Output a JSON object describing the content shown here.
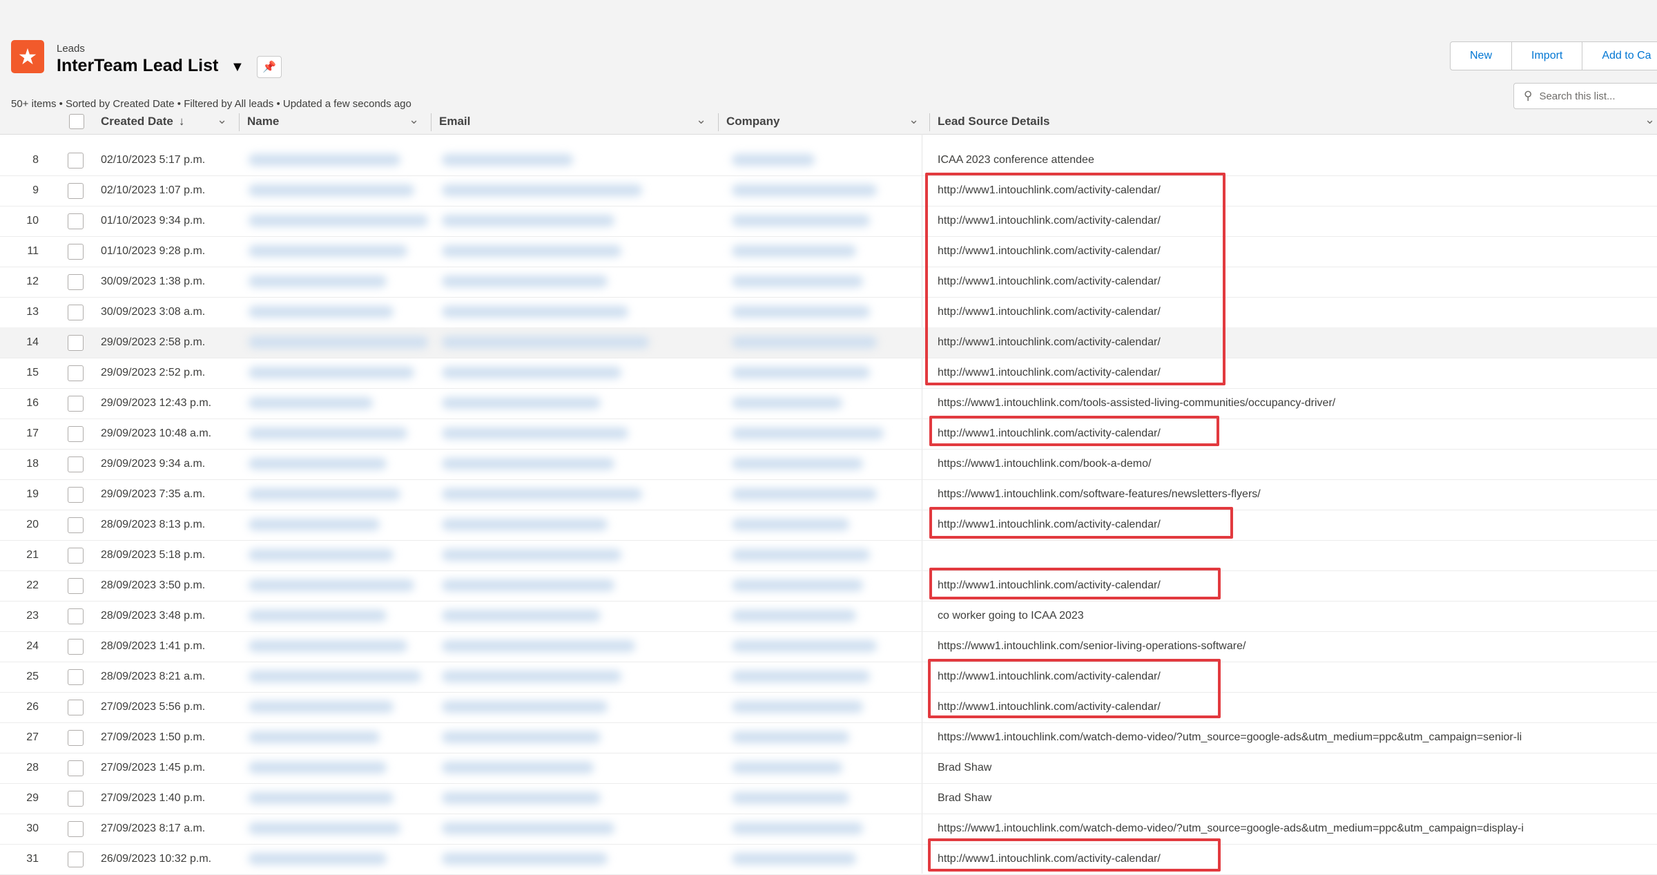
{
  "header": {
    "object_label": "Leads",
    "list_title": "InterTeam Lead List",
    "subtitle": "50+ items • Sorted by Created Date • Filtered by All leads • Updated a few seconds ago",
    "buttons": [
      "New",
      "Import",
      "Add to Ca"
    ],
    "search_placeholder": "Search this list..."
  },
  "columns": [
    "Created Date",
    "Name",
    "Email",
    "Company",
    "Lead Source Details"
  ],
  "rows": [
    {
      "num": "8",
      "date": "02/10/2023 5:17 p.m.",
      "source": "ICAA 2023 conference attendee"
    },
    {
      "num": "9",
      "date": "02/10/2023 1:07 p.m.",
      "source": "http://www1.intouchlink.com/activity-calendar/"
    },
    {
      "num": "10",
      "date": "01/10/2023 9:34 p.m.",
      "source": "http://www1.intouchlink.com/activity-calendar/"
    },
    {
      "num": "11",
      "date": "01/10/2023 9:28 p.m.",
      "source": "http://www1.intouchlink.com/activity-calendar/"
    },
    {
      "num": "12",
      "date": "30/09/2023 1:38 p.m.",
      "source": "http://www1.intouchlink.com/activity-calendar/"
    },
    {
      "num": "13",
      "date": "30/09/2023 3:08 a.m.",
      "source": "http://www1.intouchlink.com/activity-calendar/"
    },
    {
      "num": "14",
      "date": "29/09/2023 2:58 p.m.",
      "source": "http://www1.intouchlink.com/activity-calendar/"
    },
    {
      "num": "15",
      "date": "29/09/2023 2:52 p.m.",
      "source": "http://www1.intouchlink.com/activity-calendar/"
    },
    {
      "num": "16",
      "date": "29/09/2023 12:43 p.m.",
      "source": "https://www1.intouchlink.com/tools-assisted-living-communities/occupancy-driver/"
    },
    {
      "num": "17",
      "date": "29/09/2023 10:48 a.m.",
      "source": "http://www1.intouchlink.com/activity-calendar/"
    },
    {
      "num": "18",
      "date": "29/09/2023 9:34 a.m.",
      "source": "https://www1.intouchlink.com/book-a-demo/"
    },
    {
      "num": "19",
      "date": "29/09/2023 7:35 a.m.",
      "source": "https://www1.intouchlink.com/software-features/newsletters-flyers/"
    },
    {
      "num": "20",
      "date": "28/09/2023 8:13 p.m.",
      "source": "http://www1.intouchlink.com/activity-calendar/"
    },
    {
      "num": "21",
      "date": "28/09/2023 5:18 p.m.",
      "source": ""
    },
    {
      "num": "22",
      "date": "28/09/2023 3:50 p.m.",
      "source": "http://www1.intouchlink.com/activity-calendar/"
    },
    {
      "num": "23",
      "date": "28/09/2023 3:48 p.m.",
      "source": "co worker going to ICAA 2023"
    },
    {
      "num": "24",
      "date": "28/09/2023 1:41 p.m.",
      "source": "https://www1.intouchlink.com/senior-living-operations-software/"
    },
    {
      "num": "25",
      "date": "28/09/2023 8:21 a.m.",
      "source": "http://www1.intouchlink.com/activity-calendar/"
    },
    {
      "num": "26",
      "date": "27/09/2023 5:56 p.m.",
      "source": "http://www1.intouchlink.com/activity-calendar/"
    },
    {
      "num": "27",
      "date": "27/09/2023 1:50 p.m.",
      "source": "https://www1.intouchlink.com/watch-demo-video/?utm_source=google-ads&utm_medium=ppc&utm_campaign=senior-li"
    },
    {
      "num": "28",
      "date": "27/09/2023 1:45 p.m.",
      "source": "Brad Shaw"
    },
    {
      "num": "29",
      "date": "27/09/2023 1:40 p.m.",
      "source": "Brad Shaw"
    },
    {
      "num": "30",
      "date": "27/09/2023 8:17 a.m.",
      "source": "https://www1.intouchlink.com/watch-demo-video/?utm_source=google-ads&utm_medium=ppc&utm_campaign=display-i"
    },
    {
      "num": "31",
      "date": "26/09/2023 10:32 p.m.",
      "source": "http://www1.intouchlink.com/activity-calendar/"
    }
  ],
  "colors": {
    "accent": "#0176d3",
    "app_icon": "#f25a2b",
    "highlight_box": "#e23a3f"
  },
  "icons": [
    "star-icon",
    "chevron-down-icon",
    "pin-icon",
    "search-icon",
    "sort-arrow-icon"
  ]
}
